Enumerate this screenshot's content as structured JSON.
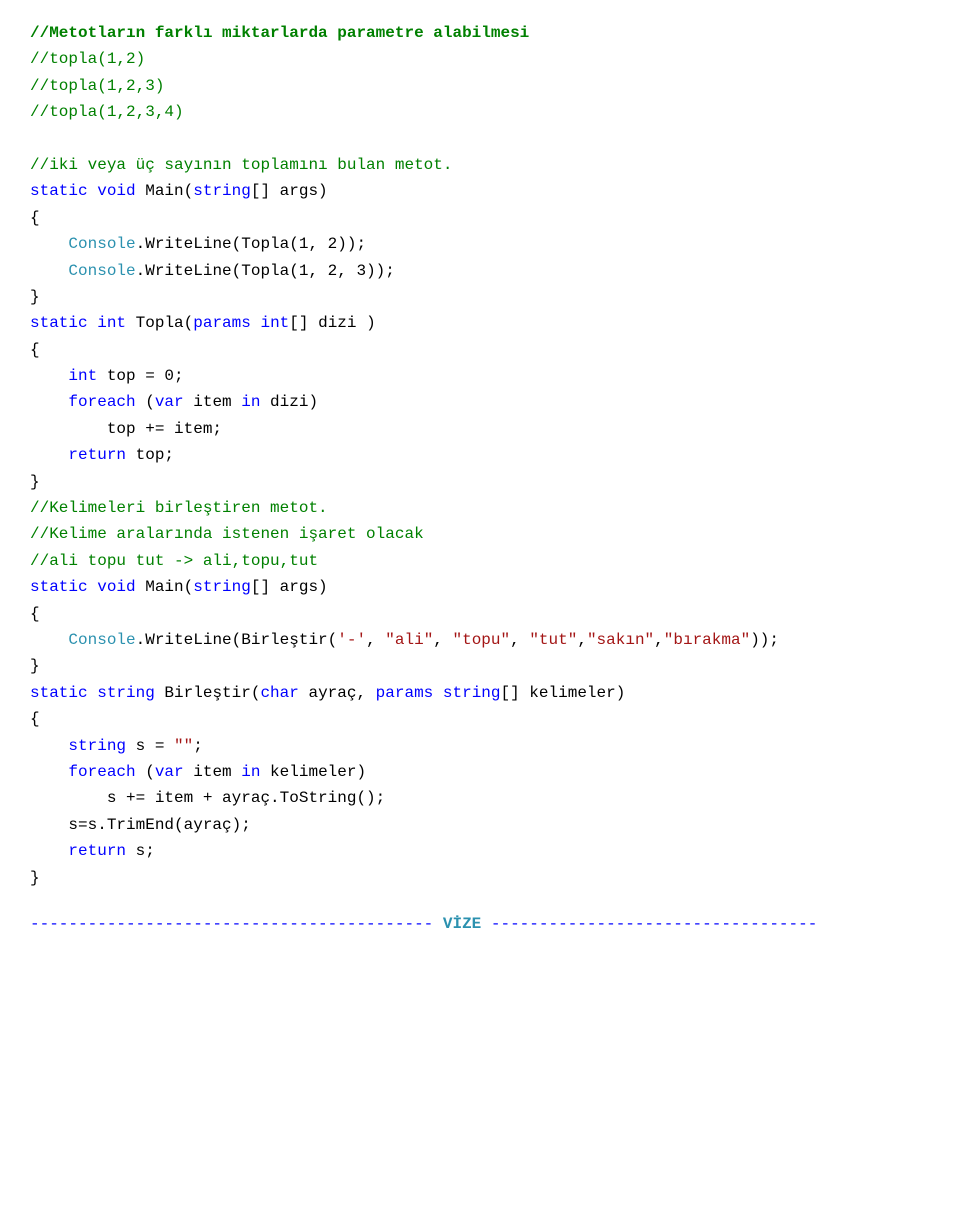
{
  "c": {
    "l1": "//Metotların farklı miktarlarda parametre alabilmesi",
    "l2": "//topla(1,2)",
    "l3": "//topla(1,2,3)",
    "l4": "//topla(1,2,3,4)",
    "l5": "",
    "l6": "//iki veya üç sayının toplamını bulan metot.",
    "kw_static": "static",
    "kw_void": "void",
    "kw_int": "int",
    "kw_string": "string",
    "kw_char": "char",
    "kw_foreach": "foreach",
    "kw_var": "var",
    "kw_in": "in",
    "kw_return": "return",
    "kw_params": "params",
    "main_sig": " Main(",
    "args": "[] args)",
    "lbrace": "{",
    "rbrace": "}",
    "console": "Console",
    "wl": ".WriteLine(Topla(1, 2));",
    "wl2": ".WriteLine(Topla(1, 2, 3));",
    "topla_sig1": " Topla(",
    "topla_sig2": "[] dizi )",
    "top_decl": " top = 0;",
    "foreach_body": " item ",
    "dizi_close": " dizi)",
    "top_inc": "        top += item;",
    "ret_top": " top;",
    "l_kelime": "//Kelimeleri birleştiren metot.",
    "l_kelime2": "//Kelime aralarında istenen işaret olacak",
    "l_ali": "//ali topu tut -> ali,topu,tut",
    "wl_birlestir1": ".WriteLine(Birleştir(",
    "char_dash": "'-'",
    "str_ali": "\"ali\"",
    "str_topu": "\"topu\"",
    "str_tut": "\"tut\"",
    "str_sakin": "\"sakın\"",
    "str_birakma": "\"bırakma\"",
    "wl_close": "));",
    "comma_sp": ", ",
    "comma": ",",
    "birlestir_sig1": " Birleştir(",
    "ayrac": " ayraç, ",
    "kelimeler_close": "[] kelimeler)",
    "s_decl": " s = ",
    "empty_str": "\"\"",
    "semi": ";",
    "kelimeler_in": " kelimeler)",
    "s_inc": "        s += item + ayraç.ToString();",
    "s_trim": "    s=s.TrimEnd(ayraç);",
    "ret_s": " s;",
    "indent4": "    ",
    "dashes_left": "------------------------------------------",
    "vize": " VİZE ",
    "dashes_right": "----------------------------------"
  }
}
